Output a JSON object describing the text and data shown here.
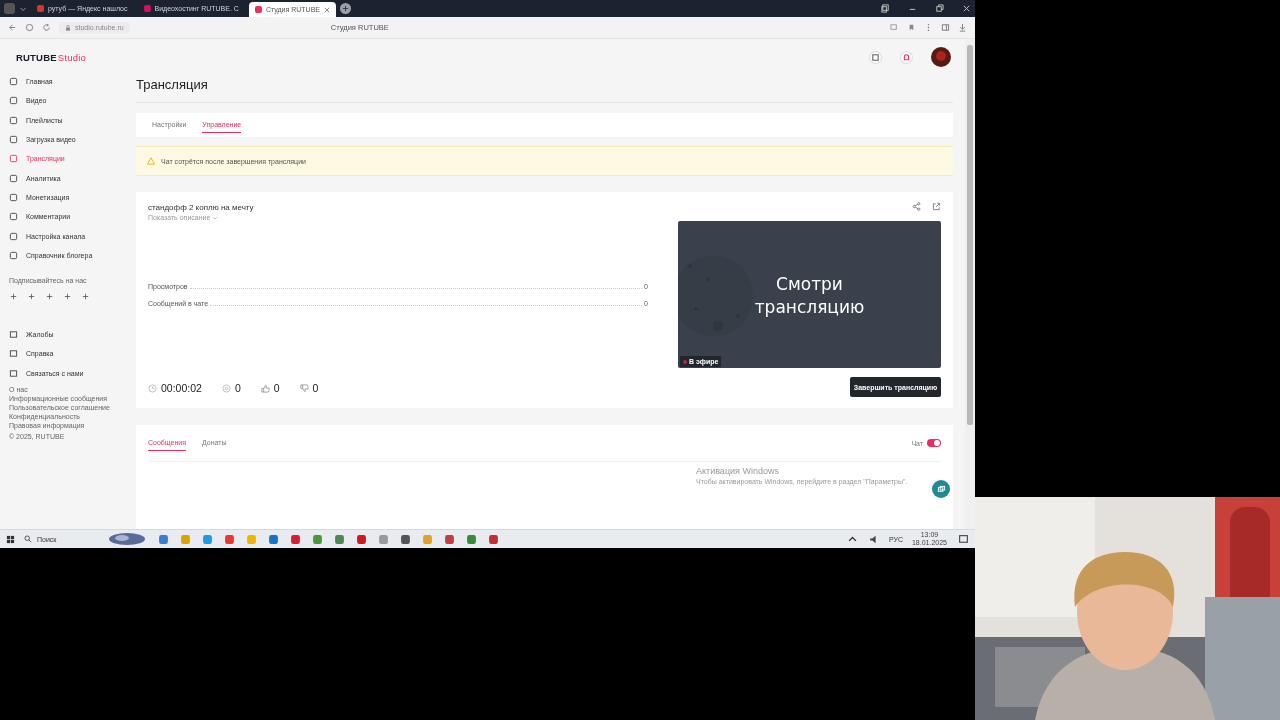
{
  "browser": {
    "tabs": [
      {
        "title": "рутуб — Яндекс нашлос",
        "selected": false
      },
      {
        "title": "Видеохостинг RUTUBE. С",
        "selected": false
      },
      {
        "title": "Студия RUTUBE",
        "selected": true
      }
    ],
    "address": "studio.rutube.ru",
    "page_title": "Студия RUTUBE"
  },
  "sidebar": {
    "logo": {
      "brand": "RUTUBE",
      "product": "Studio"
    },
    "nav": [
      {
        "label": "Главная",
        "selected": false
      },
      {
        "label": "Видео",
        "selected": false
      },
      {
        "label": "Плейлисты",
        "selected": false
      },
      {
        "label": "Загрузка видео",
        "selected": false
      },
      {
        "label": "Трансляции",
        "selected": true
      },
      {
        "label": "Аналитика",
        "selected": false
      },
      {
        "label": "Монетизация",
        "selected": false
      },
      {
        "label": "Комментарии",
        "selected": false
      },
      {
        "label": "Настройка канала",
        "selected": false
      },
      {
        "label": "Справочник блогера",
        "selected": false
      }
    ],
    "social_label": "Подписывайтесь на нас",
    "support": [
      "Жалобы",
      "Справка",
      "Связаться с нами"
    ],
    "footer_links": [
      "О нас",
      "Информационные сообщения",
      "Пользовательское соглашение",
      "Конфиденциальность",
      "Правовая информация"
    ],
    "copyright": "© 2025, RUTUBE"
  },
  "main": {
    "heading": "Трансляция",
    "tabs": [
      {
        "label": "Настройки",
        "selected": false
      },
      {
        "label": "Управление",
        "selected": true
      }
    ],
    "alert": "Чат сотрётся после завершения трансляции",
    "stream": {
      "title": "стандофф 2 коплю на мечту",
      "show_description": "Показать описание",
      "stats": [
        {
          "label": "Просмотров",
          "value": "0"
        },
        {
          "label": "Сообщений в чате",
          "value": "0"
        }
      ],
      "duration": "00:00:02",
      "viewers": "0",
      "likes": "0",
      "dislikes": "0",
      "player": {
        "overlay_text": "Смотри трансляцию",
        "badge": "В эфире"
      },
      "end_button": "Завершить трансляцию"
    },
    "chat": {
      "tabs": [
        {
          "label": "Сообщения",
          "selected": true
        },
        {
          "label": "Донаты",
          "selected": false
        }
      ],
      "toggle_label": "Чат",
      "toggle_on": true
    }
  },
  "windows_activation": {
    "title": "Активация Windows",
    "text": "Чтобы активировать Windows, перейдите в раздел \"Параметры\"."
  },
  "taskbar": {
    "search": "Поиск",
    "language": "РУС",
    "time": "13:09",
    "date": "18.01.2025"
  }
}
